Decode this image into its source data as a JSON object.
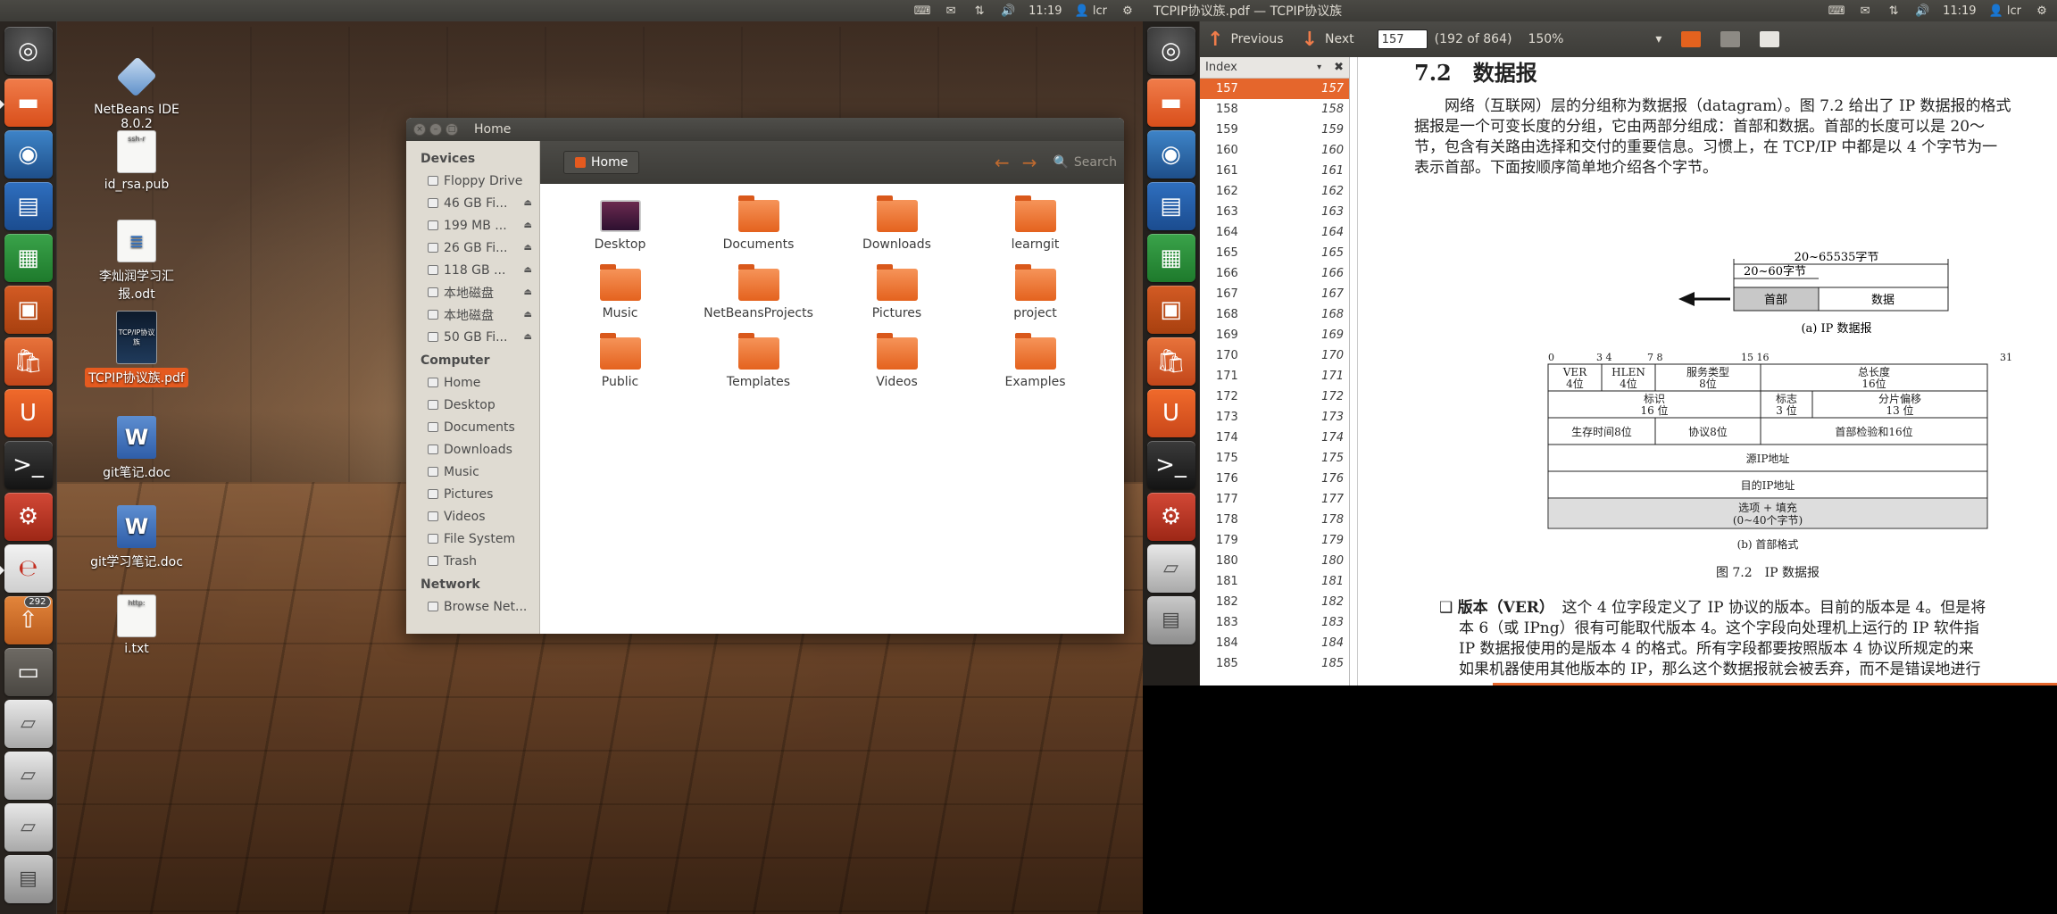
{
  "left_topbar": {
    "time": "11:19",
    "user": "lcr"
  },
  "right_topbar": {
    "title": "TCPIP协议族.pdf — TCPIP协议族",
    "time": "11:19",
    "user": "lcr"
  },
  "launcher": {
    "update_badge": "292"
  },
  "desktop_icons": [
    {
      "label": "NetBeans IDE 8.0.2",
      "icon": "netbeans-icon"
    },
    {
      "label": "id_rsa.pub",
      "icon": "text-file-icon",
      "thumb": "ssh-r"
    },
    {
      "label": "李灿润学习汇报.odt",
      "icon": "odt-file-icon"
    },
    {
      "label": "TCPIP协议族.pdf",
      "icon": "pdf-file-icon",
      "thumb": "TCP/IP协议族"
    },
    {
      "label": "git笔记.doc",
      "icon": "doc-file-icon"
    },
    {
      "label": "git学习笔记.doc",
      "icon": "doc-file-icon"
    },
    {
      "label": "i.txt",
      "icon": "text-file-icon",
      "thumb": "http:"
    }
  ],
  "nautilus": {
    "title": "Home",
    "path_label": "Home",
    "search_placeholder": "Search",
    "sidebar": {
      "devices_heading": "Devices",
      "devices": [
        "Floppy Drive",
        "46 GB Fi...",
        "199 MB ...",
        "26 GB Fi...",
        "118 GB ...",
        "本地磁盘",
        "本地磁盘",
        "50 GB Fi..."
      ],
      "computer_heading": "Computer",
      "computer": [
        "Home",
        "Desktop",
        "Documents",
        "Downloads",
        "Music",
        "Pictures",
        "Videos",
        "File System",
        "Trash"
      ],
      "network_heading": "Network",
      "network": [
        "Browse Net..."
      ]
    },
    "folders": [
      "Desktop",
      "Documents",
      "Downloads",
      "learngit",
      "Music",
      "NetBeansProjects",
      "Pictures",
      "project",
      "Public",
      "Templates",
      "Videos",
      "Examples"
    ]
  },
  "evince": {
    "prev_label": "Previous",
    "next_label": "Next",
    "page_value": "157",
    "page_count": "(192 of 864)",
    "zoom": "150%",
    "sidebar_title": "Index",
    "index": [
      {
        "label": "157",
        "page": "157"
      },
      {
        "label": "158",
        "page": "158"
      },
      {
        "label": "159",
        "page": "159"
      },
      {
        "label": "160",
        "page": "160"
      },
      {
        "label": "161",
        "page": "161"
      },
      {
        "label": "162",
        "page": "162"
      },
      {
        "label": "163",
        "page": "163"
      },
      {
        "label": "164",
        "page": "164"
      },
      {
        "label": "165",
        "page": "165"
      },
      {
        "label": "166",
        "page": "166"
      },
      {
        "label": "167",
        "page": "167"
      },
      {
        "label": "168",
        "page": "168"
      },
      {
        "label": "169",
        "page": "169"
      },
      {
        "label": "170",
        "page": "170"
      },
      {
        "label": "171",
        "page": "171"
      },
      {
        "label": "172",
        "page": "172"
      },
      {
        "label": "173",
        "page": "173"
      },
      {
        "label": "174",
        "page": "174"
      },
      {
        "label": "175",
        "page": "175"
      },
      {
        "label": "176",
        "page": "176"
      },
      {
        "label": "177",
        "page": "177"
      },
      {
        "label": "178",
        "page": "178"
      },
      {
        "label": "179",
        "page": "179"
      },
      {
        "label": "180",
        "page": "180"
      },
      {
        "label": "181",
        "page": "181"
      },
      {
        "label": "182",
        "page": "182"
      },
      {
        "label": "183",
        "page": "183"
      },
      {
        "label": "184",
        "page": "184"
      },
      {
        "label": "185",
        "page": "185"
      }
    ],
    "pdf": {
      "heading": "7.2　数据报",
      "para": [
        "网络（互联网）层的分组称为数据报（datagram）。图 7.2 给出了 IP 数据报的格式",
        "据报是一个可变长度的分组，它由两部分组成：首部和数据。首部的长度可以是 20～",
        "节，包含有关路由选择和交付的重要信息。习惯上，在 TCP/IP 中都是以 4 个字节为一",
        "表示首部。下面按顺序简单地介绍各个字节。"
      ],
      "fig_a": {
        "total": "20~65535字节",
        "hdr_len": "20~60字节",
        "header": "首部",
        "data": "数据",
        "caption": "(a) IP 数据报"
      },
      "fig_b": {
        "bits": [
          "0",
          "3 4",
          "7 8",
          "15 16",
          "31"
        ],
        "ver": "VER",
        "ver_b": "4位",
        "hlen": "HLEN",
        "hlen_b": "4位",
        "tos": "服务类型",
        "tos_b": "8位",
        "total": "总长度",
        "total_b": "16位",
        "ident": "标识",
        "ident_b": "16 位",
        "flags": "标志",
        "flags_b": "3 位",
        "frag": "分片偏移",
        "frag_b": "13 位",
        "ttl": "生存时间8位",
        "proto": "协议8位",
        "checksum": "首部检验和16位",
        "src": "源IP地址",
        "dst": "目的IP地址",
        "opts": "选项 + 填充",
        "opts_b": "(0~40个字节)",
        "caption": "(b) 首部格式",
        "fig_caption": "图 7.2　IP 数据报"
      },
      "bullet": {
        "bold": "版本（VER）",
        "lines": [
          "这个 4 位字段定义了 IP 协议的版本。目前的版本是 4。但是将",
          "本 6（或 IPng）很有可能取代版本 4。这个字段向处理机上运行的 IP 软件指",
          "IP 数据报使用的是版本 4 的格式。所有字段都要按照版本 4 协议所规定的来",
          "如果机器使用其他版本的 IP，那么这个数据报就会被丢弃，而不是错误地进行"
        ]
      }
    }
  }
}
